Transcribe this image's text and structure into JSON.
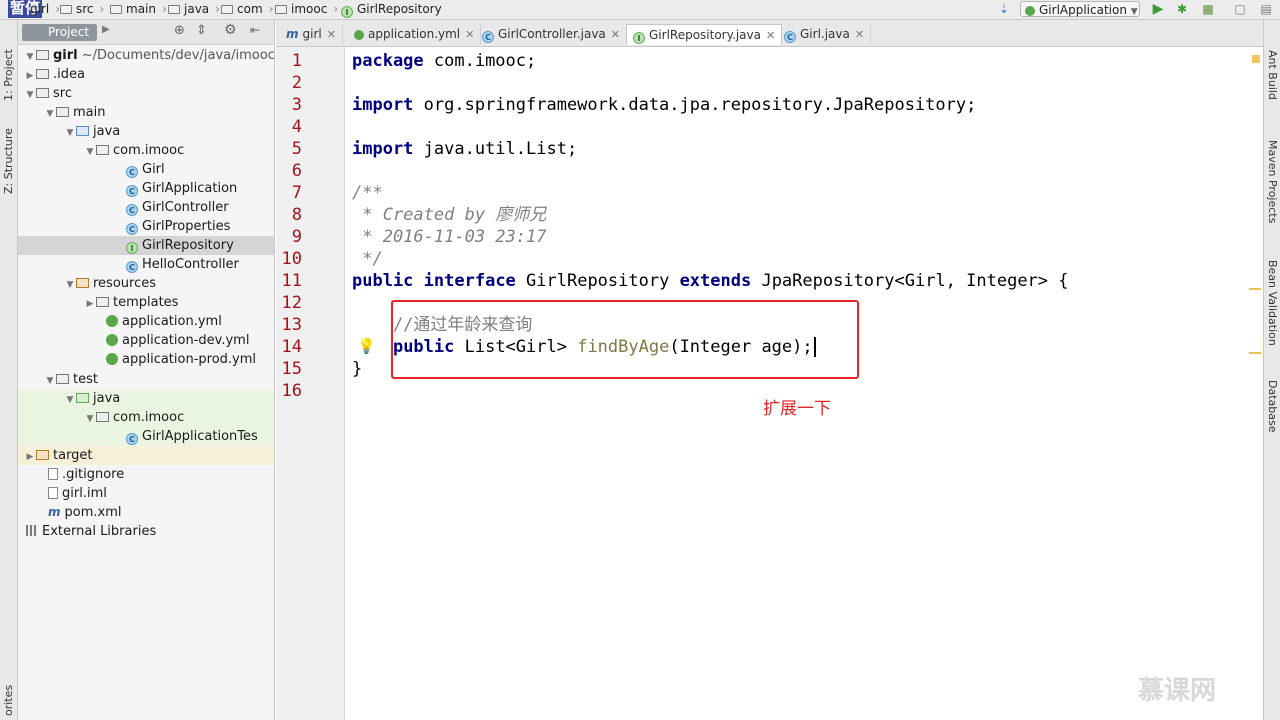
{
  "overlay": {
    "pause_label": "暂停",
    "watermark": "慕课网"
  },
  "breadcrumb": {
    "items": [
      "girl",
      "src",
      "main",
      "java",
      "com",
      "imooc",
      "GirlRepository"
    ]
  },
  "toolbar": {
    "run_config": "GirlApplication"
  },
  "left_strip": {
    "project_tab": "1: Project",
    "structure_tab": "Z: Structure",
    "favorites_tab": "orites"
  },
  "project_panel": {
    "tab_label": "Project",
    "tree": [
      {
        "label": "girl",
        "suffix": " ~/Documents/dev/java/imooc/"
      },
      {
        "label": ".idea"
      },
      {
        "label": "src"
      },
      {
        "label": "main"
      },
      {
        "label": "java"
      },
      {
        "label": "com.imooc"
      },
      {
        "label": "Girl"
      },
      {
        "label": "GirlApplication"
      },
      {
        "label": "GirlController"
      },
      {
        "label": "GirlProperties"
      },
      {
        "label": "GirlRepository"
      },
      {
        "label": "HelloController"
      },
      {
        "label": "resources"
      },
      {
        "label": "templates"
      },
      {
        "label": "application.yml"
      },
      {
        "label": "application-dev.yml"
      },
      {
        "label": "application-prod.yml"
      },
      {
        "label": "test"
      },
      {
        "label": "java"
      },
      {
        "label": "com.imooc"
      },
      {
        "label": "GirlApplicationTes"
      },
      {
        "label": "target"
      },
      {
        "label": ".gitignore"
      },
      {
        "label": "girl.iml"
      },
      {
        "label": "pom.xml"
      },
      {
        "label": "External Libraries"
      }
    ]
  },
  "editor_tabs": [
    {
      "label": "girl"
    },
    {
      "label": "application.yml"
    },
    {
      "label": "GirlController.java"
    },
    {
      "label": "GirlRepository.java"
    },
    {
      "label": "Girl.java"
    }
  ],
  "editor": {
    "line_numbers": [
      "1",
      "2",
      "3",
      "4",
      "5",
      "6",
      "7",
      "8",
      "9",
      "10",
      "11",
      "12",
      "13",
      "14",
      "15",
      "16"
    ],
    "code": {
      "l1_kw": "package",
      "l1_rest": " com.imooc;",
      "l3_kw": "import",
      "l3_rest": " org.springframework.data.jpa.repository.JpaRepository;",
      "l5_kw": "import",
      "l5_rest": " java.util.List;",
      "l7": "/**",
      "l8": " * Created by 廖师兄",
      "l9": " * 2016-11-03 23:17",
      "l10": " */",
      "l11_kw1": "public",
      "l11_kw2": "interface",
      "l11_name": " GirlRepository ",
      "l11_kw3": "extends",
      "l11_rest": " JpaRepository<Girl, Integer> {",
      "l13": "    //通过年龄来查询",
      "l14_kw": "public",
      "l14_type": " List<Girl> ",
      "l14_fn": "findByAge",
      "l14_rest": "(Integer age);",
      "l15": "}"
    }
  },
  "annotation": {
    "note": "扩展一下"
  },
  "right_strip": {
    "tabs": [
      "Ant Build",
      "Maven Projects",
      "Bean Validation",
      "Database"
    ]
  }
}
